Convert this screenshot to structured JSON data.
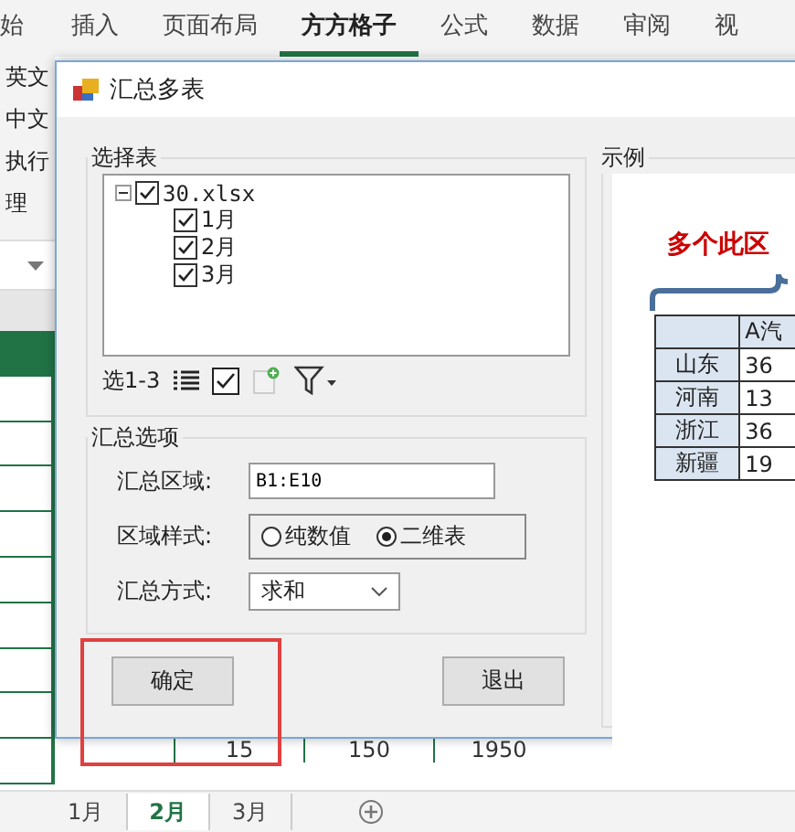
{
  "ribbon": {
    "tabs": [
      {
        "label": "始",
        "selected": false
      },
      {
        "label": "插入",
        "selected": false
      },
      {
        "label": "页面布局",
        "selected": false
      },
      {
        "label": "方方格子",
        "selected": true
      },
      {
        "label": "公式",
        "selected": false
      },
      {
        "label": "数据",
        "selected": false
      },
      {
        "label": "审阅",
        "selected": false
      },
      {
        "label": "视",
        "selected": false
      }
    ]
  },
  "side_commands": [
    "英文",
    "中文",
    "执行",
    "理"
  ],
  "sheet": {
    "bottom_row": [
      "15",
      "150",
      "1950"
    ]
  },
  "sheet_tabs": [
    {
      "label": "1月",
      "selected": false
    },
    {
      "label": "2月",
      "selected": true
    },
    {
      "label": "3月",
      "selected": false
    }
  ],
  "dialog": {
    "title": "汇总多表",
    "select_group": {
      "title": "选择表",
      "tree": {
        "label": "30.xlsx",
        "checked": true,
        "expanded": true,
        "children": [
          {
            "label": "1月",
            "checked": true
          },
          {
            "label": "2月",
            "checked": true
          },
          {
            "label": "3月",
            "checked": true
          }
        ]
      },
      "range_label": "选1-3"
    },
    "options": {
      "title": "汇总选项",
      "range_label": "汇总区域:",
      "range_value": "B1:E10",
      "style_label": "区域样式:",
      "style_options": [
        {
          "label": "纯数值",
          "selected": false
        },
        {
          "label": "二维表",
          "selected": true
        }
      ],
      "method_label": "汇总方式:",
      "method_value": "求和"
    },
    "buttons": [
      "确定",
      "退出"
    ],
    "example": {
      "title": "示例",
      "heading": "多个此区",
      "table": {
        "header": "A汽",
        "rows": [
          [
            "山东",
            "36"
          ],
          [
            "河南",
            "13"
          ],
          [
            "浙江",
            "36"
          ],
          [
            "新疆",
            "19"
          ]
        ]
      }
    }
  }
}
